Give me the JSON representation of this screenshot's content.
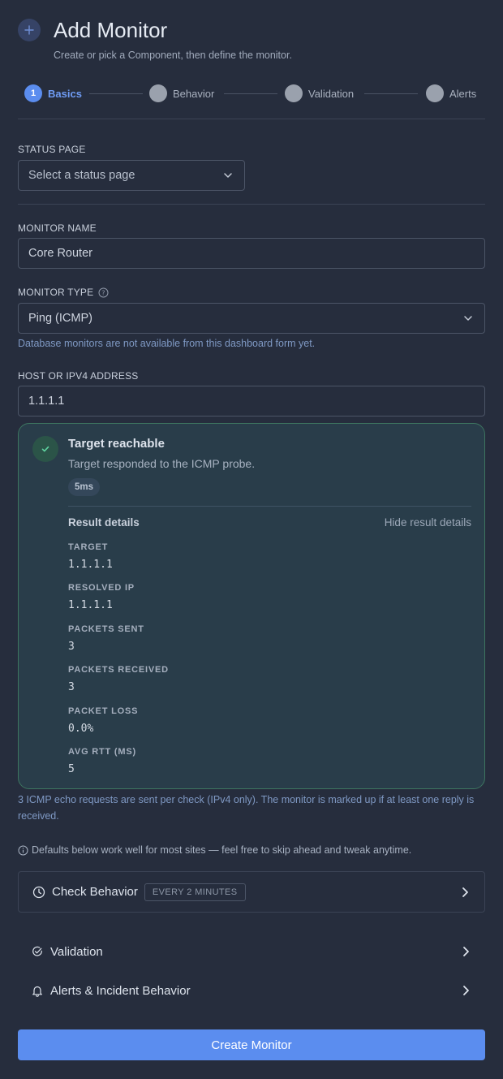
{
  "header": {
    "title": "Add Monitor",
    "subtitle": "Create or pick a Component, then define the monitor."
  },
  "stepper": {
    "steps": [
      {
        "number": "1",
        "label": "Basics",
        "active": true
      },
      {
        "number": "",
        "label": "Behavior",
        "active": false
      },
      {
        "number": "",
        "label": "Validation",
        "active": false
      },
      {
        "number": "",
        "label": "Alerts",
        "active": false
      }
    ]
  },
  "status_page": {
    "label": "STATUS PAGE",
    "placeholder": "Select a status page"
  },
  "monitor_name": {
    "label": "MONITOR NAME",
    "value": "Core Router"
  },
  "monitor_type": {
    "label": "MONITOR TYPE",
    "value": "Ping (ICMP)",
    "help": "Database monitors are not available from this dashboard form yet."
  },
  "host": {
    "label": "HOST OR IPV4 ADDRESS",
    "value": "1.1.1.1"
  },
  "result": {
    "title": "Target reachable",
    "subtitle": "Target responded to the ICMP probe.",
    "latency": "5ms",
    "details_title": "Result details",
    "hide_label": "Hide result details",
    "details": [
      {
        "key": "TARGET",
        "value": "1.1.1.1"
      },
      {
        "key": "RESOLVED IP",
        "value": "1.1.1.1"
      },
      {
        "key": "PACKETS SENT",
        "value": "3"
      },
      {
        "key": "PACKETS RECEIVED",
        "value": "3"
      },
      {
        "key": "PACKET LOSS",
        "value": "0.0%"
      },
      {
        "key": "AVG RTT (MS)",
        "value": "5"
      }
    ]
  },
  "icmp_note": "3 ICMP echo requests are sent per check (IPv4 only). The monitor is marked up if at least one reply is received.",
  "defaults_note": "Defaults below work well for most sites — feel free to skip ahead and tweak anytime.",
  "check_behavior": {
    "label": "Check Behavior",
    "badge": "EVERY 2 MINUTES"
  },
  "validation": {
    "label": "Validation"
  },
  "alerts": {
    "label": "Alerts & Incident Behavior"
  },
  "submit": {
    "label": "Create Monitor"
  },
  "colors": {
    "background": "#262d3d",
    "accent": "#5b8def",
    "success_border": "#3d7560",
    "help_text": "#7f99c4"
  }
}
